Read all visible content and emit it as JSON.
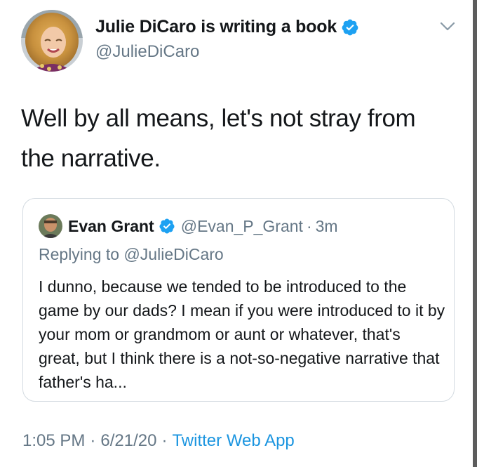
{
  "author": {
    "display_name": "Julie DiCaro is writing a book",
    "handle": "@JulieDiCaro",
    "verified": true,
    "avatar_icon": "profile-photo"
  },
  "tweet": {
    "text": "Well by all means, let's not stray from the narrative."
  },
  "quoted_tweet": {
    "display_name": "Evan Grant",
    "handle": "@Evan_P_Grant",
    "separator": "·",
    "time": "3m",
    "replying_to": "Replying to @JulieDiCaro",
    "text": "I dunno, because we tended to be introduced to the game by our dads? I mean if you were introduced to it by your mom or grandmom or aunt or whatever, that's great, but I think there is a not-so-negative narrative that father's ha..."
  },
  "meta": {
    "time": "1:05 PM",
    "separator": "·",
    "date": "6/21/20",
    "source": "Twitter Web App"
  },
  "colors": {
    "primary_text": "#14171a",
    "secondary_text": "#657786",
    "link": "#1b95e0",
    "verified_badge": "#1da1f2",
    "border": "#d4dbe1"
  },
  "icons": {
    "verified": "verified-badge-icon",
    "more": "chevron-down-icon"
  }
}
